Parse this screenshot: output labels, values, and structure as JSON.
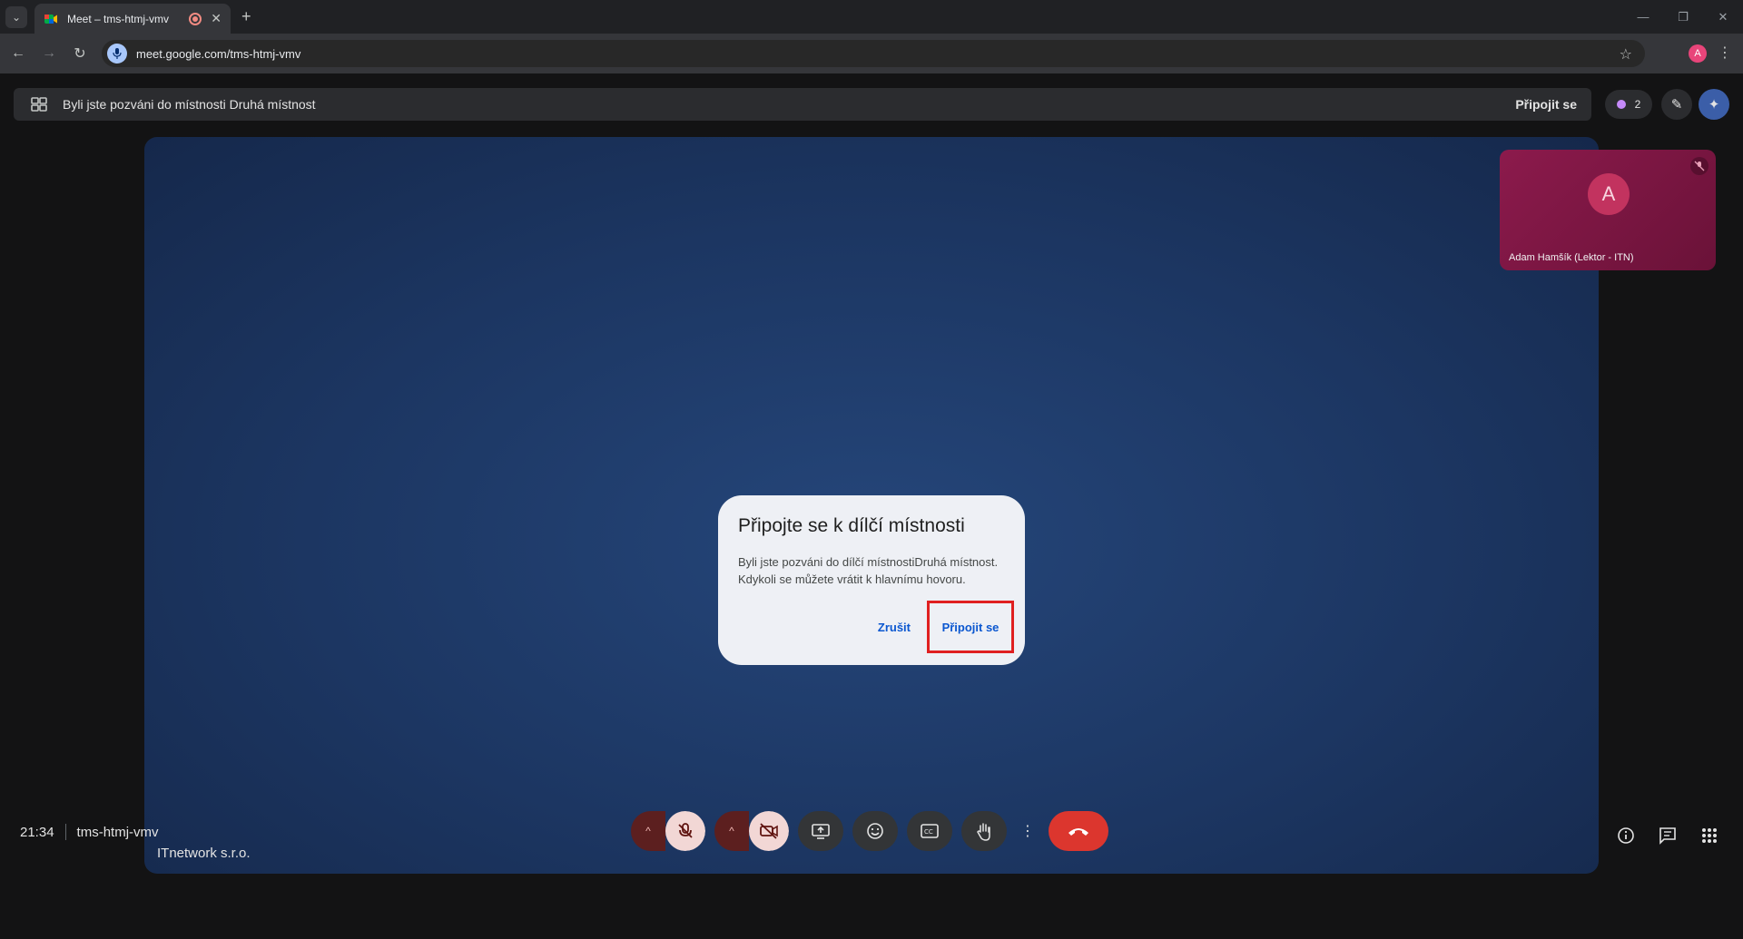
{
  "browser": {
    "tab_title": "Meet – tms-htmj-vmv",
    "url": "meet.google.com/tms-htmj-vmv",
    "profile_initial": "A"
  },
  "banner": {
    "text": "Byli jste pozváni do místnosti Druhá místnost",
    "join_label": "Připojit se",
    "participants_count": "2"
  },
  "stage": {
    "presenter_name": "ITnetwork s.r.o."
  },
  "tile": {
    "initial": "A",
    "name": "Adam Hamšík (Lektor - ITN)"
  },
  "dialog": {
    "title": "Připojte se k dílčí místnosti",
    "body_line1": "Byli jste pozváni do dílčí místnostiDruhá místnost.",
    "body_line2": "Kdykoli se můžete vrátit k hlavnímu hovoru.",
    "cancel_label": "Zrušit",
    "join_label": "Připojit se"
  },
  "footer": {
    "time": "21:34",
    "meeting_code": "tms-htmj-vmv"
  },
  "colors": {
    "stage_blue": "#1c3662",
    "tile_magenta": "#8c1a4c",
    "end_call_red": "#dc362e",
    "link_blue": "#0b57d0",
    "highlight_red": "#e02020"
  }
}
